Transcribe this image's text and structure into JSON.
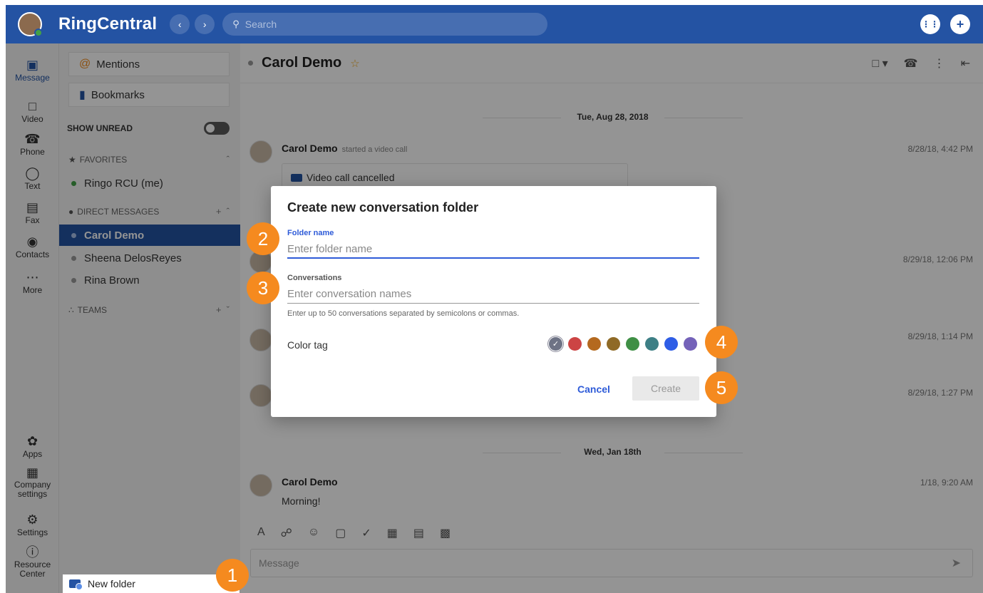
{
  "app": {
    "brand": "RingCentral",
    "search_placeholder": "Search"
  },
  "rail": {
    "items": [
      {
        "label": "Message",
        "icon": "message-icon",
        "active": true
      },
      {
        "label": "Video",
        "icon": "video-icon"
      },
      {
        "label": "Phone",
        "icon": "phone-icon"
      },
      {
        "label": "Text",
        "icon": "text-icon"
      },
      {
        "label": "Fax",
        "icon": "fax-icon"
      },
      {
        "label": "Contacts",
        "icon": "contacts-icon"
      },
      {
        "label": "More",
        "icon": "more-icon"
      }
    ],
    "bottom": [
      {
        "label": "Apps",
        "icon": "apps-icon"
      },
      {
        "label": "Company settings",
        "line1": "Company",
        "line2": "settings",
        "icon": "company-icon"
      },
      {
        "label": "Settings",
        "icon": "gear-icon"
      },
      {
        "label": "Resource Center",
        "line1": "Resource",
        "line2": "Center",
        "icon": "help-icon"
      }
    ]
  },
  "sidebar": {
    "mentions": "Mentions",
    "bookmarks": "Bookmarks",
    "show_unread": "SHOW UNREAD",
    "favorites_header": "FAVORITES",
    "favorites": [
      "Ringo RCU (me)"
    ],
    "dm_header": "DIRECT MESSAGES",
    "direct_messages": [
      "Carol Demo",
      "Sheena DelosReyes",
      "Rina Brown"
    ],
    "teams_header": "TEAMS",
    "new_folder": "New folder"
  },
  "chat": {
    "title": "Carol Demo",
    "date1": "Tue, Aug 28, 2018",
    "msg1_name": "Carol Demo",
    "msg1_sub": "started a video call",
    "msg1_time": "8/28/18, 4:42 PM",
    "video_card": "Video call cancelled",
    "time2": "8/29/18, 12:06 PM",
    "time3": "8/29/18, 1:14 PM",
    "time4": "8/29/18, 1:27 PM",
    "date2": "Wed, Jan 18th",
    "msg5_name": "Carol Demo",
    "msg5_time": "1/18, 9:20 AM",
    "msg5_text": "Morning!",
    "compose_placeholder": "Message"
  },
  "dialog": {
    "title": "Create new conversation folder",
    "folder_label": "Folder name",
    "folder_placeholder": "Enter folder name",
    "conv_label": "Conversations",
    "conv_placeholder": "Enter conversation names",
    "helper": "Enter up to 50 conversations separated by semicolons or commas.",
    "color_label": "Color tag",
    "colors": [
      "#6e7385",
      "#cc4444",
      "#b4691f",
      "#8f6a26",
      "#3f8f45",
      "#3d7f85",
      "#2e5de6",
      "#7462b9"
    ],
    "selected_color_index": 0,
    "cancel": "Cancel",
    "create": "Create"
  },
  "markers": [
    "1",
    "2",
    "3",
    "4",
    "5"
  ]
}
